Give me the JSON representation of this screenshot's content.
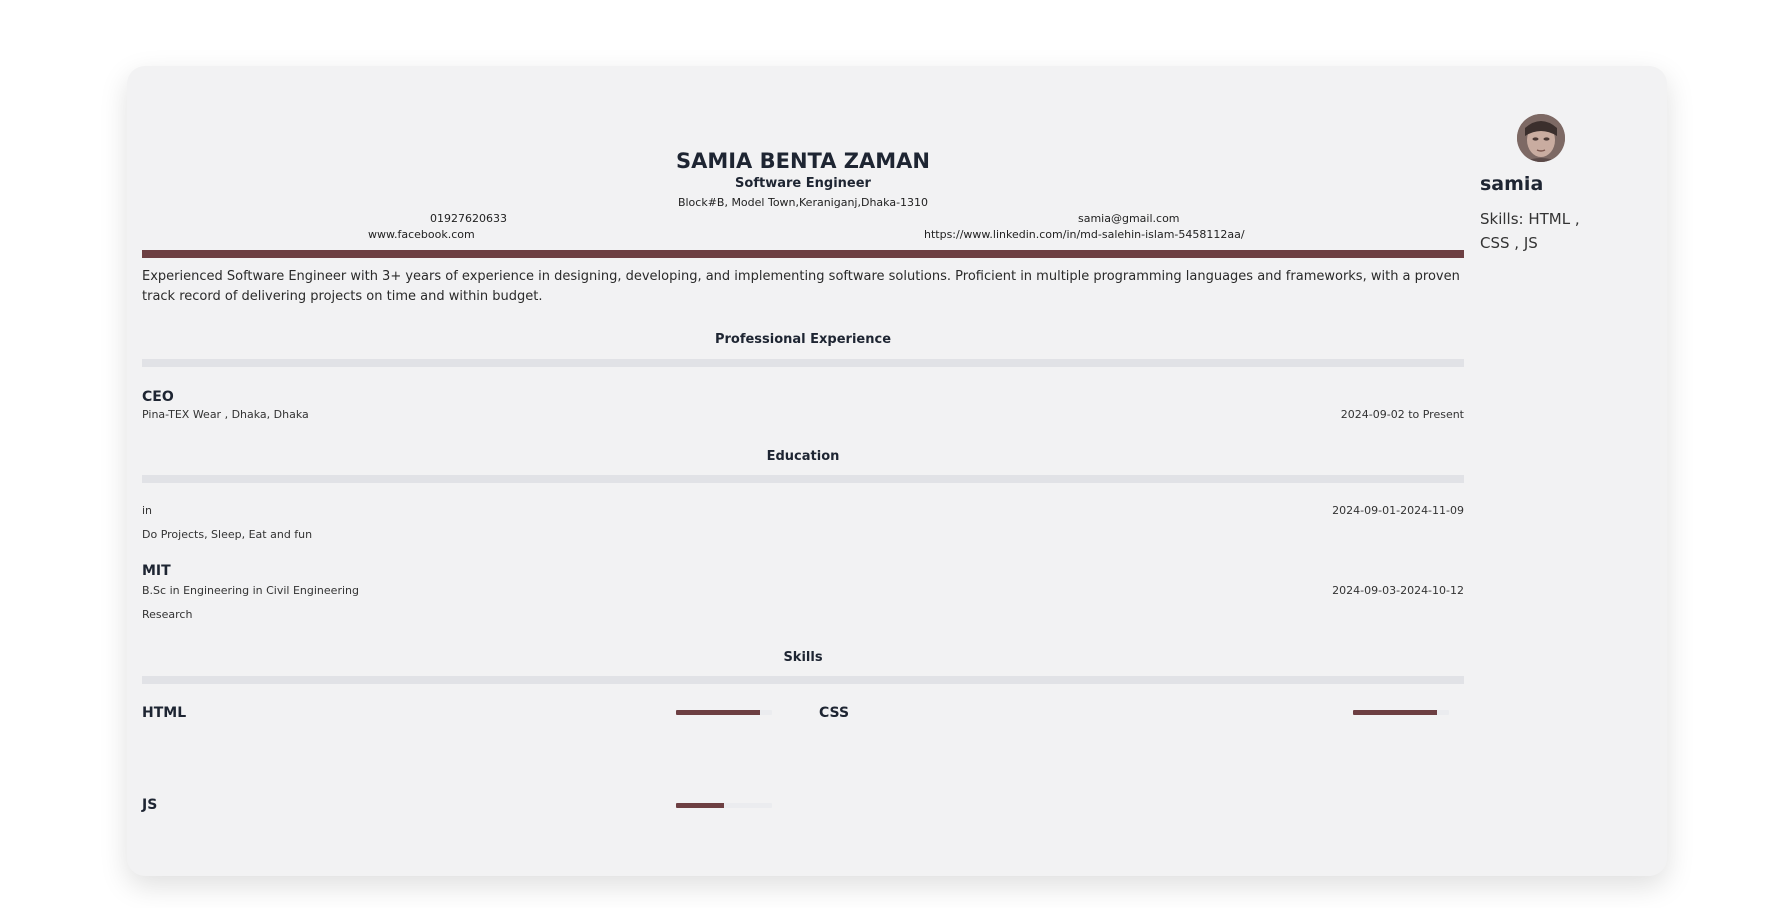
{
  "header": {
    "name": "SAMIA BENTA ZAMAN",
    "role": "Software Engineer",
    "address": "Block#B, Model Town,Keraniganj,Dhaka-1310",
    "phone": "01927620633",
    "facebook": "www.facebook.com",
    "email": "samia@gmail.com",
    "linkedin": "https://www.linkedin.com/in/md-salehin-islam-5458112aa/"
  },
  "summary": "Experienced Software Engineer with 3+ years of experience in designing, developing, and implementing software solutions. Proficient in multiple programming languages and frameworks, with a proven track record of delivering projects on time and within budget.",
  "experience": {
    "title": "Professional Experience",
    "jobs": [
      {
        "position": "CEO",
        "company": "Pina-TEX Wear , Dhaka, Dhaka",
        "dates": "2024-09-02 to Present"
      }
    ]
  },
  "education": {
    "title": "Education",
    "items": [
      {
        "institution": "",
        "degree": "in",
        "dates": "2024-09-01-2024-11-09",
        "description": "Do Projects, Sleep, Eat and fun"
      },
      {
        "institution": "MIT",
        "degree": "B.Sc in Engineering in Civil Engineering",
        "dates": "2024-09-03-2024-10-12",
        "description": "Research"
      }
    ]
  },
  "skills": {
    "title": "Skills",
    "items": [
      {
        "name": "HTML",
        "level": 0.88
      },
      {
        "name": "CSS",
        "level": 0.88
      },
      {
        "name": "JS",
        "level": 0.5
      }
    ]
  },
  "sidebar": {
    "username": "samia",
    "skills_text": "Skills: HTML , CSS , JS",
    "avatar_icon": "user-avatar-photo"
  },
  "colors": {
    "accent": "#6d3f42",
    "card_bg": "#f2f2f3",
    "divider_light": "#e1e2e6"
  }
}
